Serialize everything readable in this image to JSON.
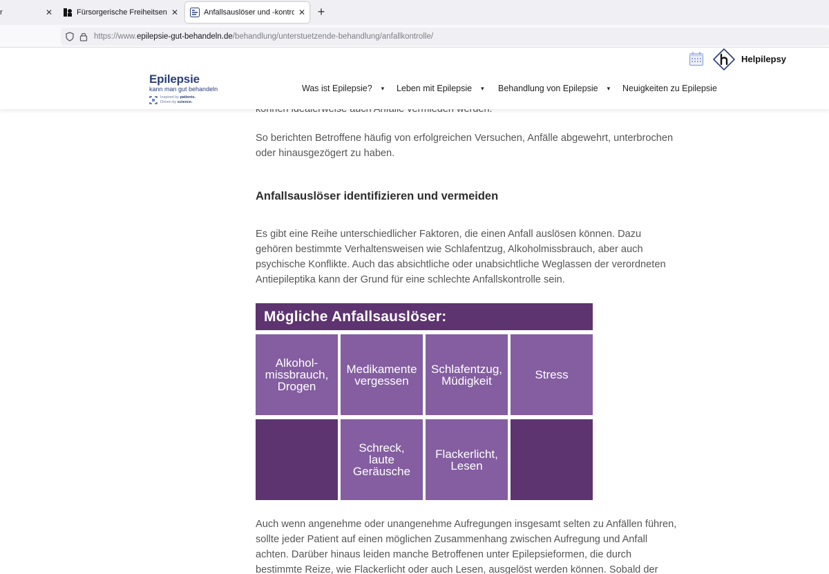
{
  "browser": {
    "tabs": [
      {
        "label": "r",
        "active": false
      },
      {
        "label": "Fürsorgerische Freiheitsentziehung",
        "active": false
      },
      {
        "label": "Anfallsauslöser und -kontrolle bei Epilepsie",
        "active": true
      }
    ],
    "url": {
      "prefix": "https://www.",
      "host": "epilepsie-gut-behandeln.de",
      "path": "/behandlung/unterstuetzende-behandlung/anfallkontrolle/"
    }
  },
  "header": {
    "logo": {
      "title": "Epilepsie",
      "subtitle": "kann man gut behandeln",
      "tag_line1_pre": "Inspired by ",
      "tag_line1_bold": "patients.",
      "tag_line2_pre": "Driven by ",
      "tag_line2_bold": "science."
    },
    "helpilepsy_label": "Helpilepsy",
    "nav": [
      {
        "label": "Was ist Epilepsie?",
        "has_dropdown": true
      },
      {
        "label": "Leben mit Epilepsie",
        "has_dropdown": true
      },
      {
        "label": "Behandlung von Epilepsie",
        "has_dropdown": true
      },
      {
        "label": "Neuigkeiten zu Epilepsie",
        "has_dropdown": false
      }
    ]
  },
  "content": {
    "cut_line": "können idealerweise auch Anfälle vermieden werden.",
    "para1": "So berichten Betroffene häufig von erfolgreichen Versuchen, Anfälle abgewehrt, unterbrochen oder hinausgezögert zu haben.",
    "heading": "Anfallsauslöser identifizieren und vermeiden",
    "para2": "Es gibt eine Reihe unterschiedlicher Faktoren, die einen Anfall auslösen können. Dazu gehören bestimmte Verhaltensweisen wie Schlafentzug, Alkoholmissbrauch, aber auch psychische Konflikte. Auch das absichtliche oder unabsichtliche Weglassen der verordneten Antiepileptika kann der Grund für eine schlechte Anfallskontrolle sein.",
    "para3": "Auch wenn angenehme oder unangenehme Aufregungen insgesamt selten zu Anfällen führen, sollte jeder Patient auf einen möglichen Zusammenhang zwischen Aufregung und Anfall achten. Darüber hinaus leiden manche Betroffenen unter Epilepsieformen, die durch bestimmte Reize, wie Flackerlicht oder auch Lesen, ausgelöst werden können. Sobald der"
  },
  "infographic": {
    "title": "Mögliche Anfallsauslöser:",
    "cells": [
      "Alkohol-\nmissbrauch,\nDrogen",
      "Medikamente\nvergessen",
      "Schlafentzug,\nMüdigkeit",
      "Stress",
      "",
      "Schreck,\nlaute\nGeräusche",
      "Flackerlicht,\nLesen",
      ""
    ]
  },
  "colors": {
    "purple_dark": "#5d3370",
    "purple_light": "#845ea0",
    "logo_blue": "#2a3f7a"
  }
}
